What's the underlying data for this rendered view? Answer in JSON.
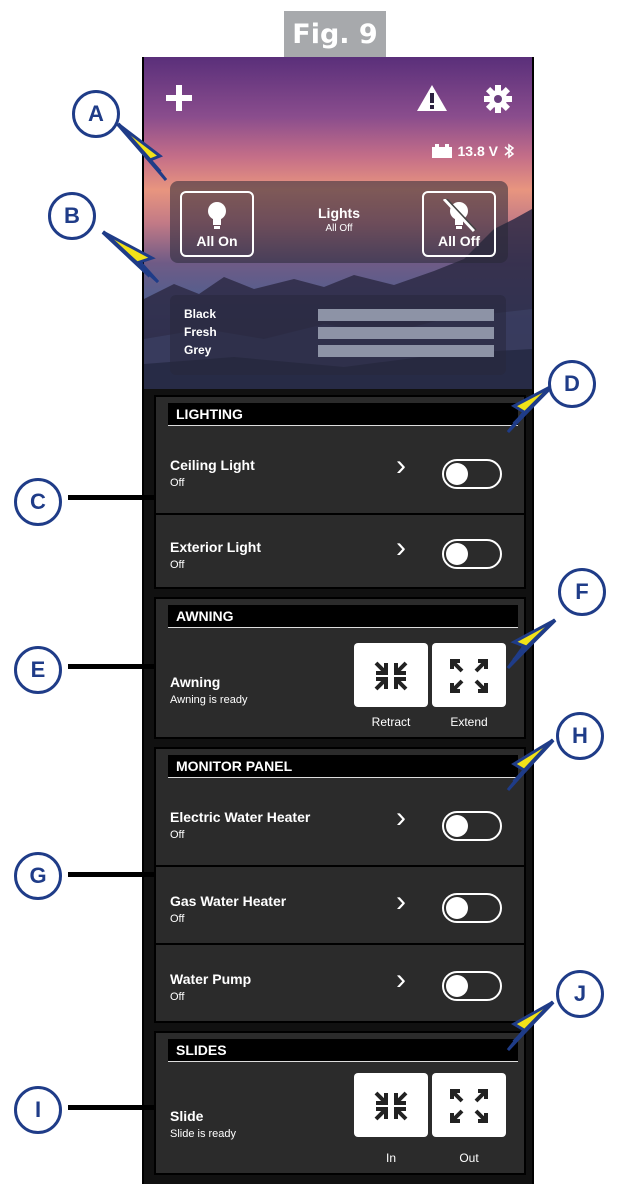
{
  "figure": {
    "label": "Fig. 9"
  },
  "header": {
    "add_icon": "plus-icon",
    "warning_icon": "warning-icon",
    "settings_icon": "gear-icon"
  },
  "status": {
    "voltage": "13.8 V",
    "battery_icon": "battery-icon",
    "bluetooth_icon": "bluetooth-icon"
  },
  "lights": {
    "all_on_label": "All On",
    "title": "Lights",
    "subtitle": "All Off",
    "all_off_label": "All Off"
  },
  "tanks": {
    "items": [
      "Black",
      "Fresh",
      "Grey"
    ]
  },
  "lighting": {
    "heading": "LIGHTING",
    "rows": [
      {
        "title": "Ceiling Light",
        "status": "Off"
      },
      {
        "title": "Exterior Light",
        "status": "Off"
      }
    ]
  },
  "awning": {
    "heading": "AWNING",
    "title": "Awning",
    "status": "Awning is ready",
    "retract_label": "Retract",
    "extend_label": "Extend"
  },
  "monitor": {
    "heading": "MONITOR PANEL",
    "rows": [
      {
        "title": "Electric Water Heater",
        "status": "Off"
      },
      {
        "title": "Gas Water Heater",
        "status": "Off"
      },
      {
        "title": "Water Pump",
        "status": "Off"
      }
    ]
  },
  "slides": {
    "heading": "SLIDES",
    "title": "Slide",
    "status": "Slide is ready",
    "in_label": "In",
    "out_label": "Out"
  },
  "callouts": {
    "a": "A",
    "b": "B",
    "c": "C",
    "d": "D",
    "e": "E",
    "f": "F",
    "g": "G",
    "h": "H",
    "i": "I",
    "j": "J"
  }
}
